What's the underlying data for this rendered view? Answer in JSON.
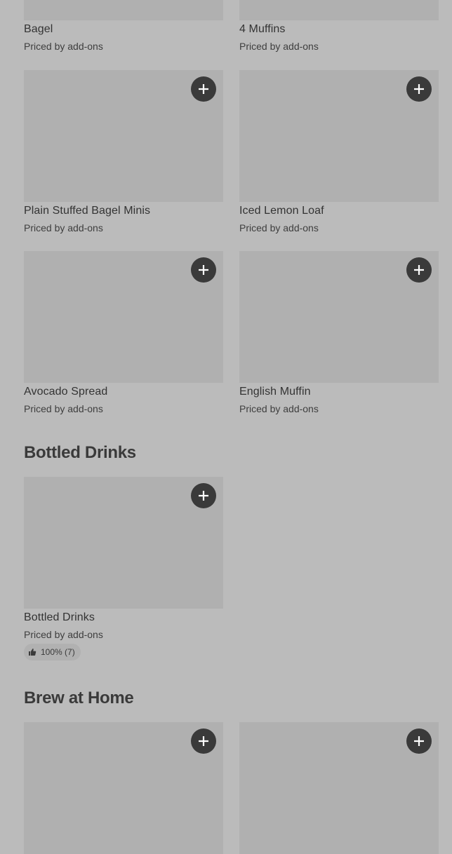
{
  "sections": [
    {
      "title": "",
      "items": [
        {
          "name": "Bagel",
          "price": "Priced by add-ons"
        },
        {
          "name": "4 Muffins",
          "price": "Priced by add-ons"
        },
        {
          "name": "Plain Stuffed Bagel Minis",
          "price": "Priced by add-ons"
        },
        {
          "name": "Iced Lemon Loaf",
          "price": "Priced by add-ons"
        },
        {
          "name": "Avocado Spread",
          "price": "Priced by add-ons"
        },
        {
          "name": "English Muffin",
          "price": "Priced by add-ons"
        }
      ]
    },
    {
      "title": "Bottled Drinks",
      "items": [
        {
          "name": "Bottled Drinks",
          "price": "Priced by add-ons",
          "rating": "100% (7)"
        }
      ]
    },
    {
      "title": "Brew at Home",
      "items": [
        {
          "name": "",
          "price": ""
        },
        {
          "name": "",
          "price": ""
        }
      ]
    }
  ],
  "icons": {
    "add": "plus-icon",
    "rating": "thumbs-up-icon"
  },
  "colors": {
    "background": "#bbbbbb",
    "image_placeholder": "#b0b0b0",
    "add_button": "#3a3a3a"
  }
}
